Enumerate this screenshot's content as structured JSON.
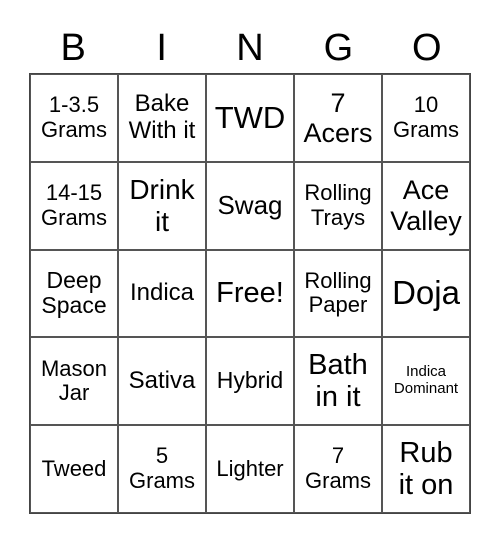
{
  "header": [
    "B",
    "I",
    "N",
    "G",
    "O"
  ],
  "cells": [
    "1-3.5\nGrams",
    "Bake\nWith it",
    "TWD",
    "7\nAcers",
    "10\nGrams",
    "14-15\nGrams",
    "Drink\nit",
    "Swag",
    "Rolling\nTrays",
    "Ace\nValley",
    "Deep\nSpace",
    "Indica",
    "Free!",
    "Rolling\nPaper",
    "Doja",
    "Mason\nJar",
    "Sativa",
    "Hybrid",
    "Bath\nin it",
    "Indica\nDominant",
    "Tweed",
    "5\nGrams",
    "Lighter",
    "7\nGrams",
    "Rub\nit on"
  ]
}
